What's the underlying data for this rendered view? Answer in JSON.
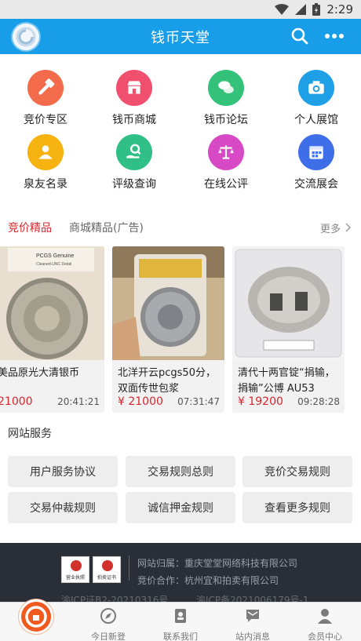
{
  "status": {
    "time": "2:29"
  },
  "header": {
    "title": "钱币天堂"
  },
  "grid": [
    {
      "label": "竞价专区",
      "icon": "gavel-icon",
      "color": "#f36b4a"
    },
    {
      "label": "钱币商城",
      "icon": "shop-icon",
      "color": "#f0506e"
    },
    {
      "label": "钱币论坛",
      "icon": "chat-icon",
      "color": "#34c27a"
    },
    {
      "label": "个人展馆",
      "icon": "camera-icon",
      "color": "#1e9fe6"
    },
    {
      "label": "泉友名录",
      "icon": "user-icon",
      "color": "#f6b30f"
    },
    {
      "label": "评级查询",
      "icon": "search-hand-icon",
      "color": "#2fbf87"
    },
    {
      "label": "在线公评",
      "icon": "scale-icon",
      "color": "#d84ac5"
    },
    {
      "label": "交流展会",
      "icon": "calendar-icon",
      "color": "#3f6fe8"
    }
  ],
  "tabs": {
    "active": "竞价精品",
    "other": "商城精品(广告)",
    "more": "更多"
  },
  "cards": [
    {
      "title": "美品原光大清银币",
      "price": "21000",
      "time": "20:41:21"
    },
    {
      "title": "北洋开云pcgs50分，双面传世包浆",
      "price": "¥ 21000",
      "time": "07:31:47"
    },
    {
      "title": "清代十两官锭“捐输，捐输”公博 AU53",
      "price": "¥ 19200",
      "time": "09:28:28"
    }
  ],
  "services": {
    "title": "网站服务",
    "buttons": [
      "用户服务协议",
      "交易规则总则",
      "竞价交易规则",
      "交易仲裁规则",
      "诚信押金规则",
      "查看更多规则"
    ]
  },
  "footer": {
    "licenses": [
      "营业执照",
      "拍卖证书"
    ],
    "owner": "网站归属：重庆堂堂网络科技有限公司",
    "partner": "竞价合作：杭州宜和拍卖有限公司",
    "icp1": "渝ICP证B2-20210316号",
    "icp2": "渝ICP备2021006179号-1"
  },
  "nav": [
    {
      "label": "今日新登",
      "icon": "compass-icon"
    },
    {
      "label": "联系我们",
      "icon": "contacts-icon"
    },
    {
      "label": "站内消息",
      "icon": "message-icon"
    },
    {
      "label": "会员中心",
      "icon": "member-icon"
    }
  ]
}
